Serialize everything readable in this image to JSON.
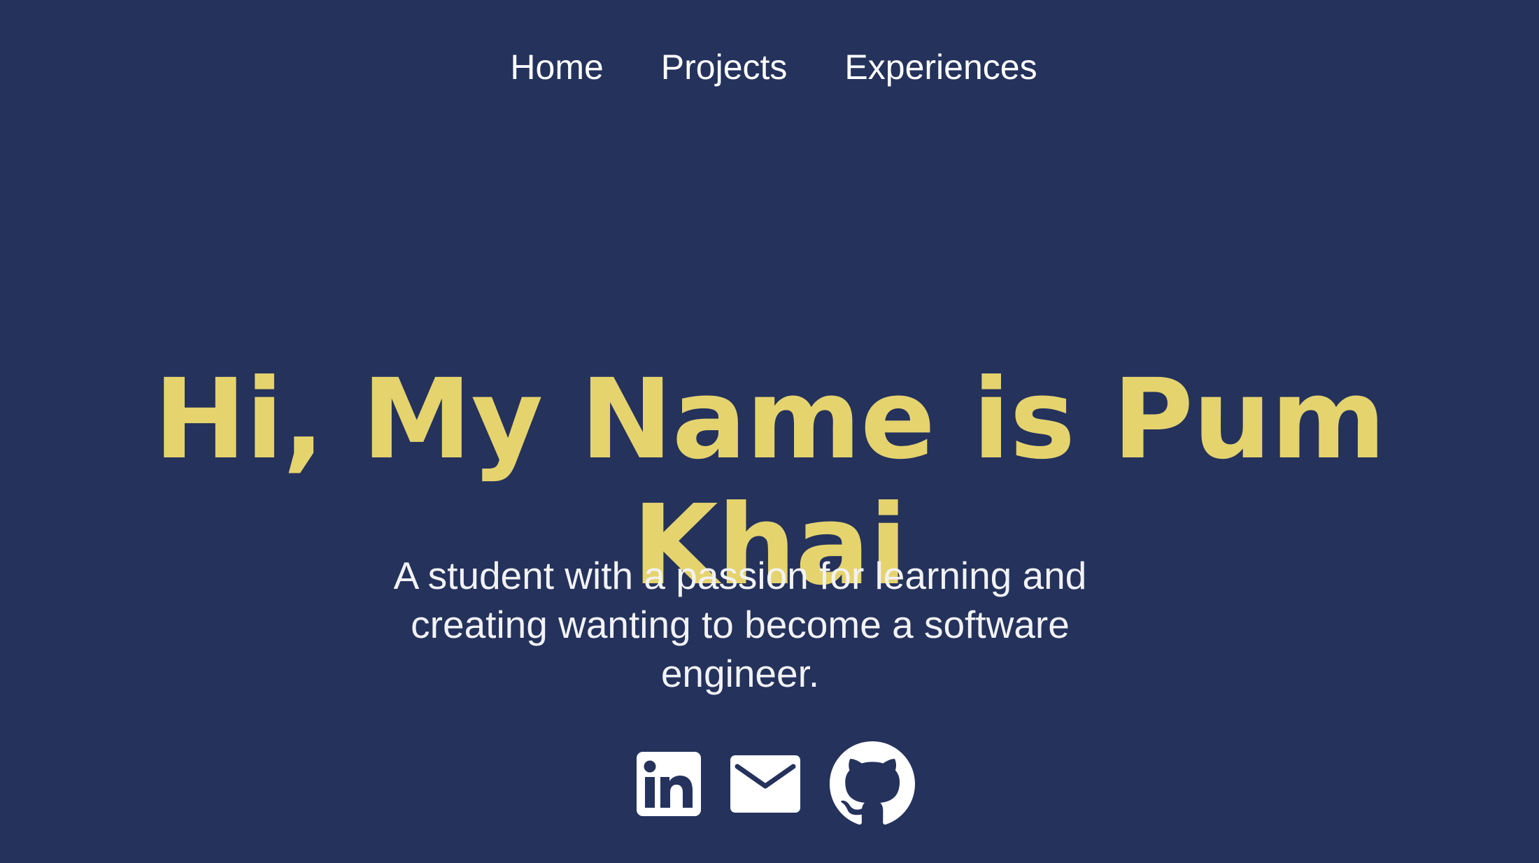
{
  "nav": {
    "items": [
      {
        "label": "Home"
      },
      {
        "label": "Projects"
      },
      {
        "label": "Experiences"
      }
    ]
  },
  "hero": {
    "title": "Hi, My Name is Pum Khai",
    "tagline": "A student with a passion for learning and creating wanting to become a software engineer."
  },
  "social": {
    "icons": [
      "linkedin-icon",
      "email-icon",
      "github-icon"
    ]
  },
  "colors": {
    "background": "#24325c",
    "accent": "#e5d36e",
    "text": "#ffffff"
  }
}
